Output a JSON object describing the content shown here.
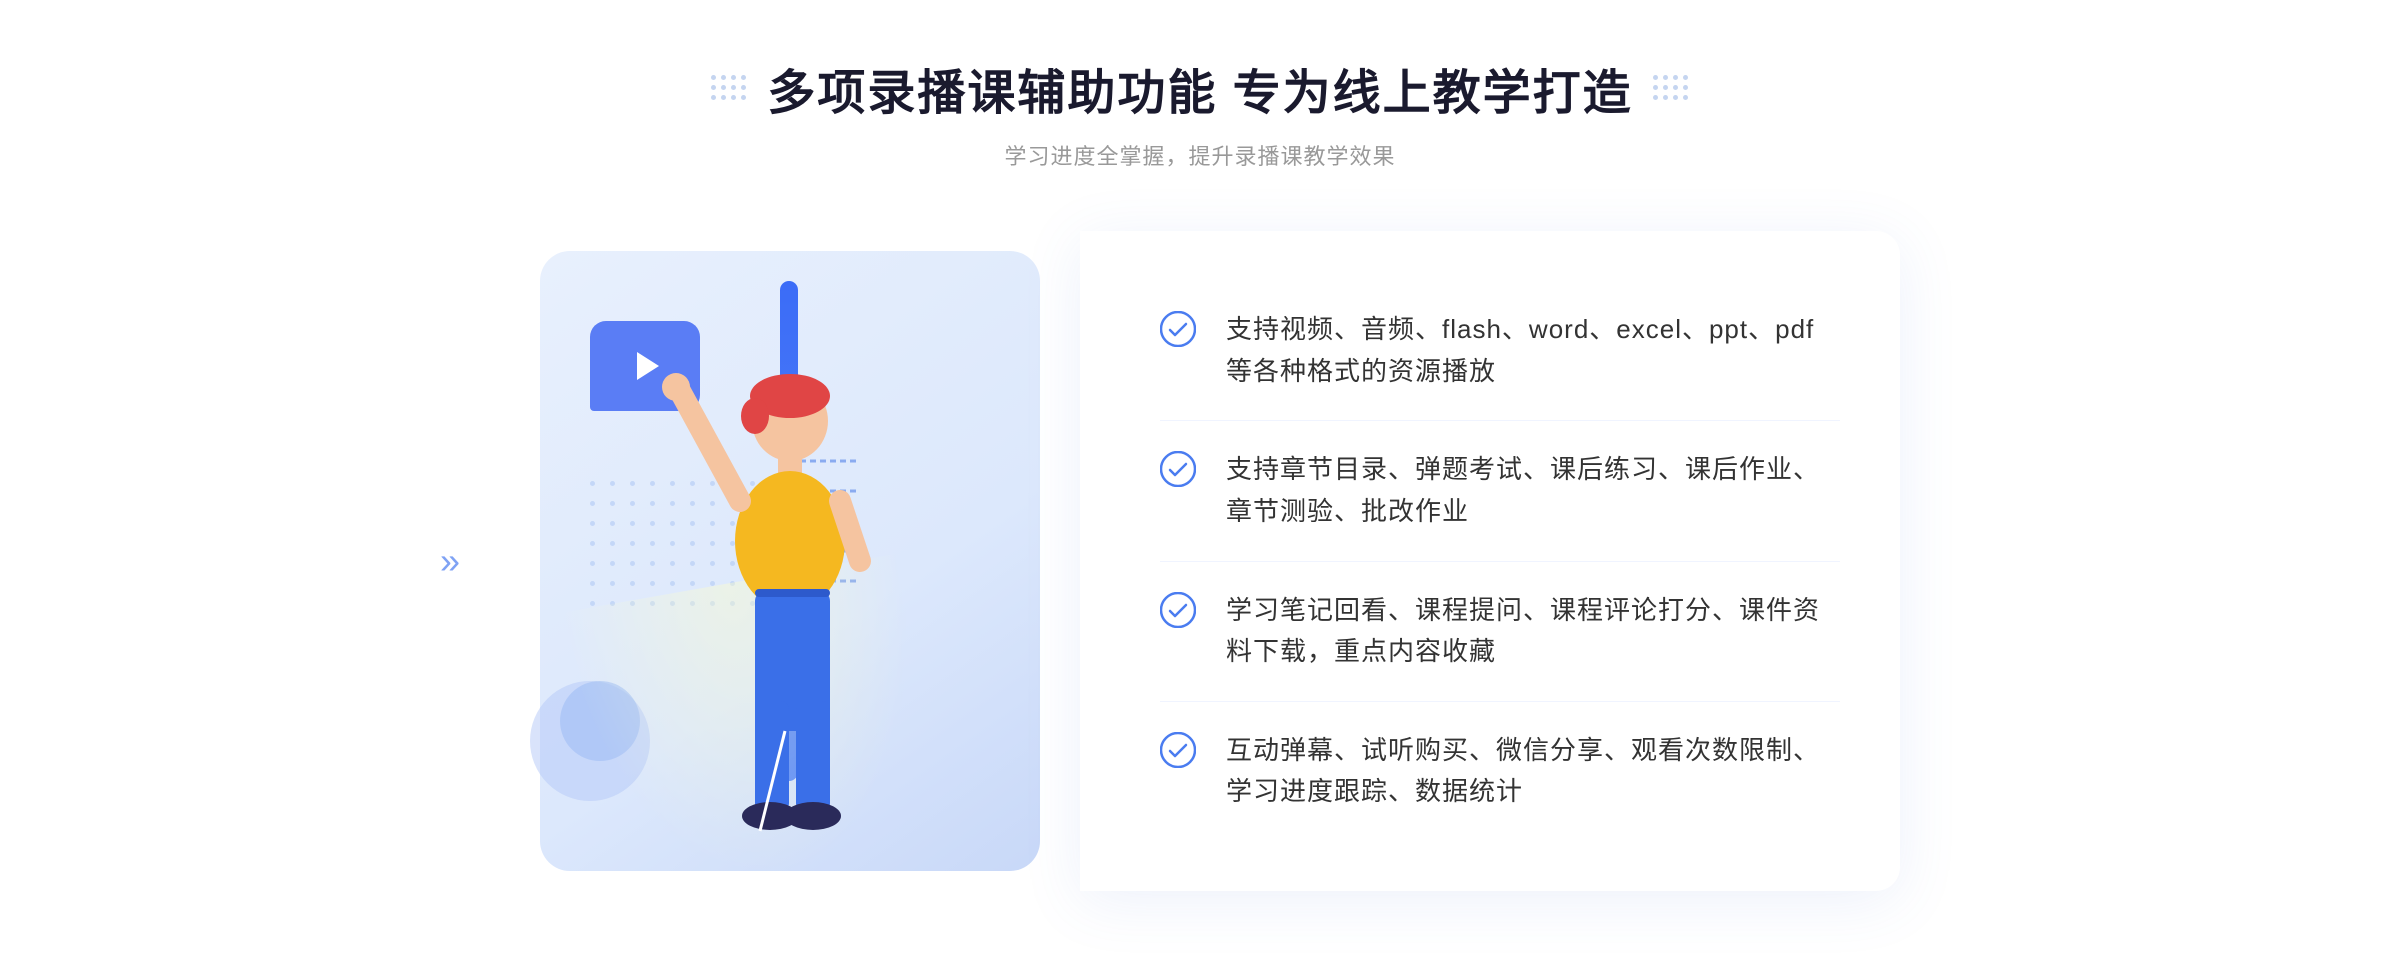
{
  "header": {
    "title": "多项录播课辅助功能 专为线上教学打造",
    "subtitle": "学习进度全掌握，提升录播课教学效果"
  },
  "features": [
    {
      "id": "feature-1",
      "text": "支持视频、音频、flash、word、excel、ppt、pdf等各种格式的资源播放"
    },
    {
      "id": "feature-2",
      "text": "支持章节目录、弹题考试、课后练习、课后作业、章节测验、批改作业"
    },
    {
      "id": "feature-3",
      "text": "学习笔记回看、课程提问、课程评论打分、课件资料下载，重点内容收藏"
    },
    {
      "id": "feature-4",
      "text": "互动弹幕、试听购买、微信分享、观看次数限制、学习进度跟踪、数据统计"
    }
  ],
  "decorative": {
    "check_color": "#4a7cf0",
    "accent_color": "#3b6cf7"
  }
}
